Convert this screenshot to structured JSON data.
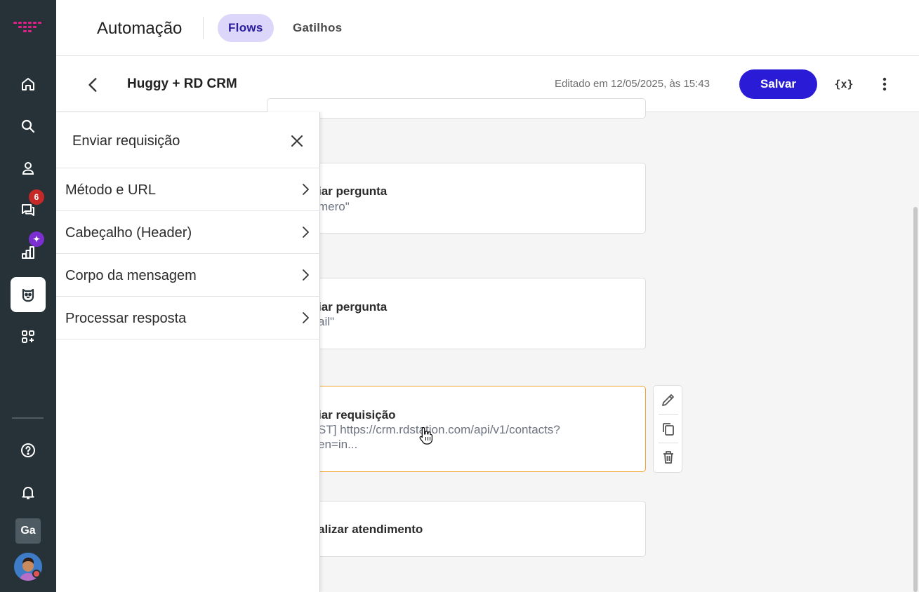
{
  "header": {
    "title": "Automação",
    "tabs": [
      {
        "label": "Flows",
        "active": true
      },
      {
        "label": "Gatilhos",
        "active": false
      }
    ]
  },
  "subheader": {
    "flow_name": "Huggy + RD CRM",
    "edited": "Editado em 12/05/2025, às 15:43",
    "save_label": "Salvar",
    "variables_icon_text": "{x}"
  },
  "rail": {
    "chat_badge": "6",
    "reports_badge": "✦",
    "user_initials": "Ga",
    "items": [
      "home-icon",
      "search-icon",
      "contacts-icon",
      "chats-icon",
      "reports-icon",
      "automation-icon",
      "apps-icon",
      "help-icon",
      "bell-icon"
    ]
  },
  "panel": {
    "title": "Enviar requisição",
    "rows": [
      {
        "label": "Método e URL"
      },
      {
        "label": "Cabeçalho (Header)"
      },
      {
        "label": "Corpo da mensagem"
      },
      {
        "label": "Processar resposta"
      }
    ]
  },
  "canvas": {
    "cards": [
      {
        "title": "iar pergunta",
        "subtitle": "mero\""
      },
      {
        "title": "iar pergunta",
        "subtitle": "ail\""
      },
      {
        "title": "iar requisição",
        "subtitle": "ST] https://crm.rdstation.com/api/v1/contacts?",
        "subtitle2": "en=in..."
      },
      {
        "title": "alizar atendimento"
      }
    ]
  },
  "colors": {
    "rail_bg": "#263238",
    "primary": "#2a1cd6",
    "tab_active_bg": "#dcd7fa",
    "selected_border": "#f0a32a",
    "badge_red": "#c62828",
    "badge_purple": "#7b2fd1"
  }
}
